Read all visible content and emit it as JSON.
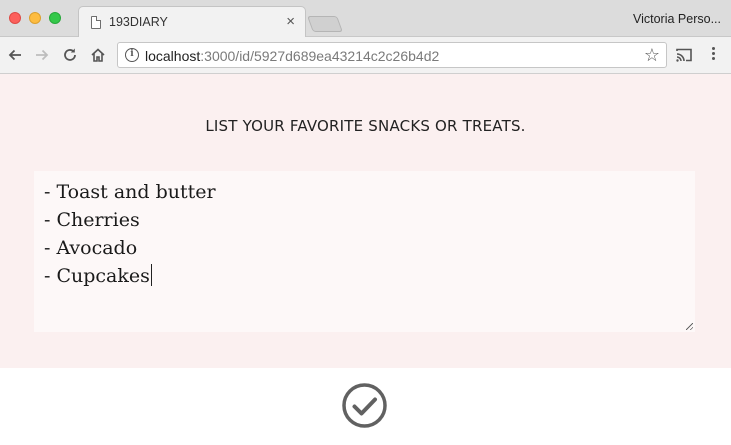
{
  "browser": {
    "tab": {
      "title": "193DIARY",
      "close_glyph": "×"
    },
    "profile_name": "Victoria Perso...",
    "address": {
      "host": "localhost",
      "path": ":3000/id/5927d689ea43214c2c26b4d2"
    },
    "icons": {
      "back": "arrow-left",
      "forward": "arrow-right",
      "reload": "reload",
      "home": "home",
      "info": "i",
      "star": "☆",
      "cast": "cast",
      "menu": "kebab-menu"
    }
  },
  "page": {
    "prompt": "LIST YOUR FAVORITE SNACKS OR TREATS.",
    "entry_lines": [
      "- Toast and butter",
      "- Cherries",
      "- Avocado",
      "- Cupcakes"
    ],
    "submit_icon": "check-circle"
  },
  "colors": {
    "content_bg": "#fbf0f0",
    "textarea_bg": "#fdf8f8",
    "icon_gray": "#616161"
  }
}
